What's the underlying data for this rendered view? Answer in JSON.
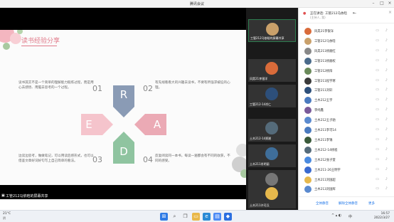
{
  "window": {
    "title": "腾讯会议"
  },
  "slide": {
    "title": "读书经验分享",
    "letters": {
      "top": "R",
      "left": "E",
      "right": "A",
      "bottom": "D"
    },
    "items": [
      {
        "num": "01",
        "text": "读书其实不是一个简单的理解能力锻炼过程，而是用心去感悟、用脑去思考的一个过程。"
      },
      {
        "num": "02",
        "text": "有先线看看大的兴趣去读书，不要有所强求被迫的心理。"
      },
      {
        "num": "03",
        "text": "边读边思考，做做笔记，可以用读后感形式，也可以借鉴文章好词好句写上自己简单的看法。"
      },
      {
        "num": "04",
        "text": "反复阅读同一本书，每读一遍都会有不同的收获，不同的感受。"
      }
    ]
  },
  "presenter": {
    "label": "工管212马依晗的屏幕共享"
  },
  "videos": [
    {
      "name": "工管212马依晗的屏幕共享",
      "color": "#c9a06a",
      "active": true
    },
    {
      "name": "风昊21李银洋",
      "color": "#d96b3a",
      "active": false
    },
    {
      "name": "工管212-14肖仁",
      "color": "#2d4f7a",
      "active": false
    },
    {
      "name": "土木212-14郑湘",
      "color": "#556b7a",
      "active": false
    },
    {
      "name": "土木211肖明丽",
      "color": "#3f6e9a",
      "active": false
    },
    {
      "name": "风昊21杨顺红",
      "color": "#777777",
      "active": false
    },
    {
      "name": "土木211许可兵",
      "color": "#e6b84c",
      "active": false
    }
  ],
  "panel": {
    "host": "正在讲话: 工管212马依晗",
    "host_sub": "(主持人, 我)",
    "members": [
      {
        "name": "风昊21李银洋",
        "color": "#d96b3a"
      },
      {
        "name": "工管212马依晗",
        "color": "#c9a06a"
      },
      {
        "name": "风昊211杨顺红",
        "color": "#888888"
      },
      {
        "name": "工管211杨顺权",
        "color": "#4a6a8a"
      },
      {
        "name": "工管212杨阳",
        "color": "#6a8a5a"
      },
      {
        "name": "工管211程宇寒",
        "color": "#3a3a3a"
      },
      {
        "name": "工管211刘轩",
        "color": "#2d4f7a"
      },
      {
        "name": "土木212王宇",
        "color": "#4a7abf"
      },
      {
        "name": "李纯鑫",
        "color": "#7a5a9a"
      },
      {
        "name": "土木212王子驰",
        "color": "#5a8acf"
      },
      {
        "name": "土木211李可14",
        "color": "#4a7abf"
      },
      {
        "name": "土木211李锦",
        "color": "#3a5a3a"
      },
      {
        "name": "土木212-14杨程",
        "color": "#556b7a"
      },
      {
        "name": "土木212张子萱",
        "color": "#4a8adf"
      },
      {
        "name": "土木211-26王明宇",
        "color": "#3a6acf"
      },
      {
        "name": "土木211刘国超",
        "color": "#e6b84c"
      },
      {
        "name": "土木213刘国辉",
        "color": "#5a8acf"
      }
    ],
    "footer": {
      "mute_all": "全体静音",
      "unmute_all": "解除全体静音",
      "more": "更多"
    }
  },
  "taskbar": {
    "weather_temp": "21°C",
    "weather_desc": "阴",
    "time": "16:57",
    "date": "2022/3/27",
    "lang": "中"
  }
}
